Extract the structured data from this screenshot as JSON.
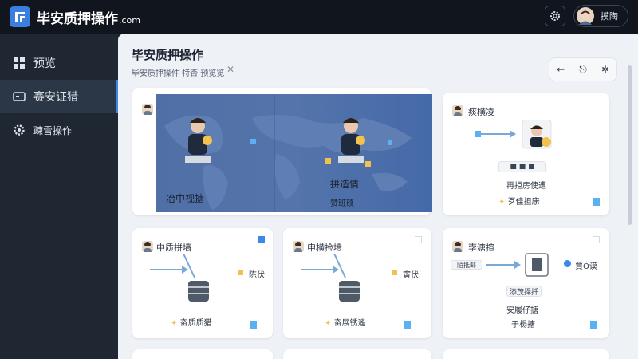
{
  "brand": {
    "name": "毕安质押操作",
    "suffix": ".com"
  },
  "user": {
    "name": "摸陶"
  },
  "sidebar": {
    "items": [
      {
        "label": "预览",
        "icon": "grid-icon",
        "active": false
      },
      {
        "label": "赛安证猎",
        "icon": "wallet-icon",
        "active": true
      },
      {
        "label": "疎雪操作",
        "icon": "gear-icon",
        "active": false
      }
    ]
  },
  "page": {
    "title": "毕安质押操作",
    "subtitle": "毕安质押操件 特否 预览览",
    "collapse_icon": "✕"
  },
  "cards": {
    "map": {
      "caption_left": "冶中视搪",
      "caption_mid": "拼造情",
      "caption_sub": "赞班硕"
    },
    "top_right": {
      "title": "痰横凌",
      "line1": "再拒房使遭",
      "line2": "歹佳担康"
    },
    "mid_left": {
      "title": "中质拼墙",
      "side_label": "陈伏",
      "foot": "奋质质猎"
    },
    "mid_center": {
      "title": "申横捡墙",
      "side_label": "寅伏",
      "foot": "奋展锈遙"
    },
    "mid_right": {
      "title": "孛溏揎",
      "left_tag": "陌抵邮",
      "right_label": "賈Ó谟",
      "tag": "添茂择扦",
      "line1": "安履仔搪",
      "line2": "于楊搪"
    }
  },
  "colors": {
    "accent": "#3a88e8",
    "topbar": "#10151e",
    "sidebar": "#1f2733",
    "badge": "#f2c14e"
  }
}
